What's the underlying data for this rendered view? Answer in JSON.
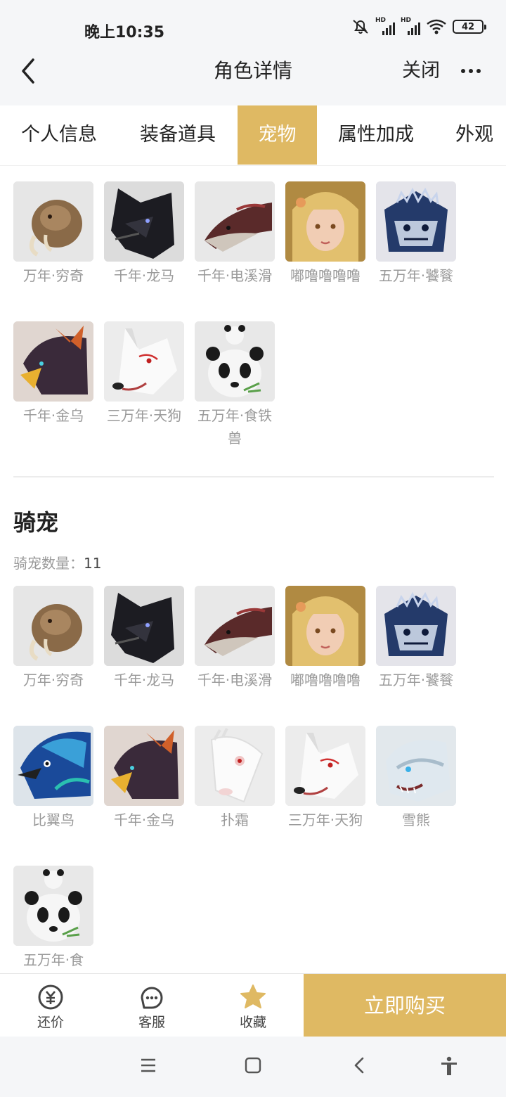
{
  "status": {
    "time": "晚上10:35",
    "battery": "42",
    "hd_label": "HD"
  },
  "nav": {
    "title": "角色详情",
    "close": "关闭"
  },
  "tabs": [
    {
      "label": "个人信息",
      "active": false
    },
    {
      "label": "装备道具",
      "active": false
    },
    {
      "label": "宠物",
      "active": true
    },
    {
      "label": "属性加成",
      "active": false
    },
    {
      "label": "外观",
      "active": false
    }
  ],
  "pets": [
    {
      "name": "万年·穷奇",
      "icon": "qiongqi-icon"
    },
    {
      "name": "千年·龙马",
      "icon": "longma-icon"
    },
    {
      "name": "千年·电溪滑",
      "icon": "dianxihua-icon"
    },
    {
      "name": "嘟噜噜噜噜",
      "icon": "girl-avatar-icon"
    },
    {
      "name": "五万年·饕餮",
      "icon": "taotie-icon"
    },
    {
      "name": "千年·金乌",
      "icon": "jinwu-icon"
    },
    {
      "name": "三万年·天狗",
      "icon": "tiangou-icon"
    },
    {
      "name": "五万年·食铁兽",
      "icon": "panda-icon"
    }
  ],
  "mounts": {
    "heading": "骑宠",
    "count_label": "骑宠数量：",
    "count": "11",
    "items": [
      {
        "name": "万年·穷奇",
        "icon": "qiongqi-icon"
      },
      {
        "name": "千年·龙马",
        "icon": "longma-icon"
      },
      {
        "name": "千年·电溪滑",
        "icon": "dianxihua-icon"
      },
      {
        "name": "嘟噜噜噜噜",
        "icon": "girl-avatar-icon"
      },
      {
        "name": "五万年·饕餮",
        "icon": "taotie-icon"
      },
      {
        "name": "比翼鸟",
        "icon": "biyiniao-icon"
      },
      {
        "name": "千年·金乌",
        "icon": "jinwu-icon"
      },
      {
        "name": "扑霜",
        "icon": "pushuang-icon"
      },
      {
        "name": "三万年·天狗",
        "icon": "tiangou-icon"
      },
      {
        "name": "雪熊",
        "icon": "xuexiong-icon"
      },
      {
        "name": "五万年·食",
        "icon": "panda-icon"
      }
    ]
  },
  "bottom_bar": {
    "bargain": "还价",
    "service": "客服",
    "favorite": "收藏",
    "buy": "立即购买",
    "accent_color": "#dfb963"
  }
}
